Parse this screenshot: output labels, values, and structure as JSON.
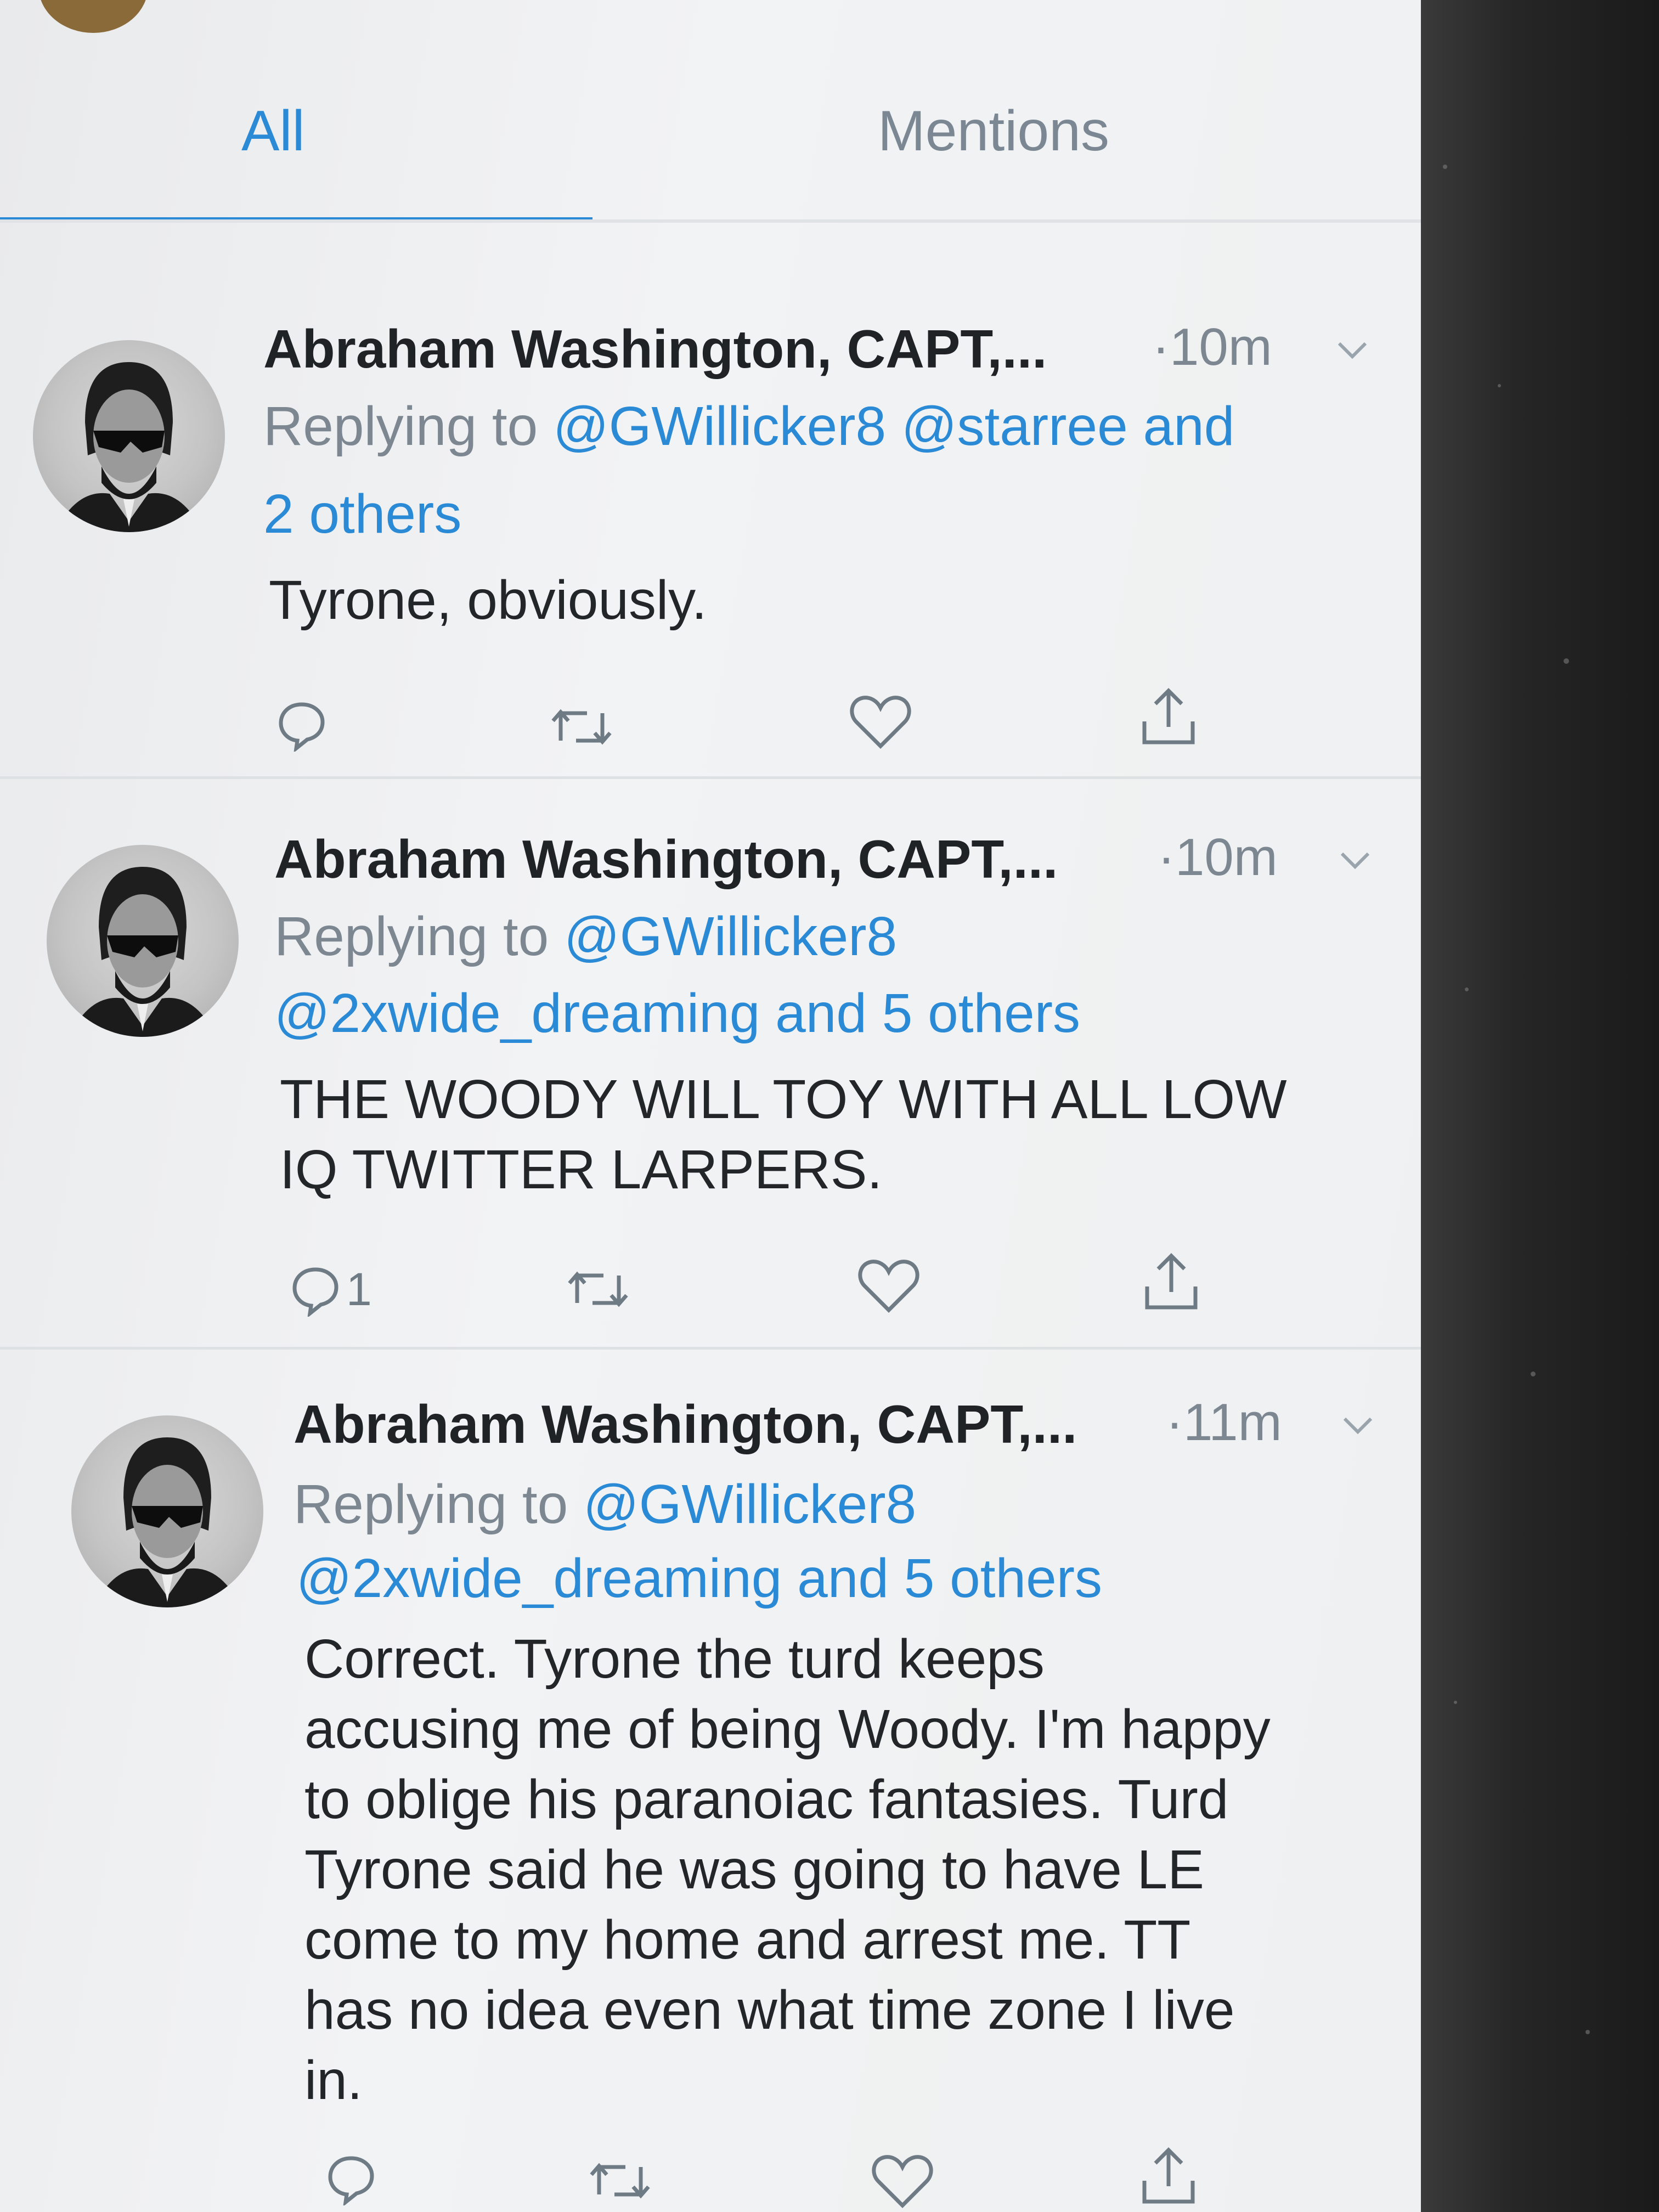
{
  "tabs": {
    "all": "All",
    "mentions": "Mentions",
    "active": "all"
  },
  "colors": {
    "accent": "#2a8ad6",
    "muted": "#7c8791",
    "text": "#222628"
  },
  "tweets": [
    {
      "name": "Abraham Washington, CAPT,...",
      "time": "·10m",
      "reply_prefix": "Replying to",
      "reply_line1": "@GWillicker8 @starree",
      "reply_and1": "and",
      "reply_line2": "2 others",
      "body": "Tyrone, obviously.",
      "reply_count": "",
      "icons": [
        "reply-icon",
        "retweet-icon",
        "like-icon",
        "share-icon"
      ]
    },
    {
      "name": "Abraham Washington, CAPT,...",
      "time": "·10m",
      "reply_prefix": "Replying to",
      "reply_line1": "@GWillicker8",
      "reply_line2": "@2xwide_dreaming and 5 others",
      "body": "THE WOODY WILL TOY WITH ALL LOW\nIQ TWITTER LARPERS.",
      "reply_count": "1",
      "icons": [
        "reply-icon",
        "retweet-icon",
        "like-icon",
        "share-icon"
      ]
    },
    {
      "name": "Abraham Washington, CAPT,...",
      "time": "·11m",
      "reply_prefix": "Replying to",
      "reply_line1": "@GWillicker8",
      "reply_line2": "@2xwide_dreaming and 5 others",
      "body": "Correct. Tyrone the turd keeps\naccusing me of being Woody. I'm happy\nto oblige his paranoiac fantasies. Turd\nTyrone said he was going to have LE\ncome to my home and arrest me. TT\nhas no idea even what time zone I live\nin.",
      "reply_count": "",
      "icons": [
        "reply-icon",
        "retweet-icon",
        "like-icon",
        "share-icon"
      ]
    }
  ]
}
